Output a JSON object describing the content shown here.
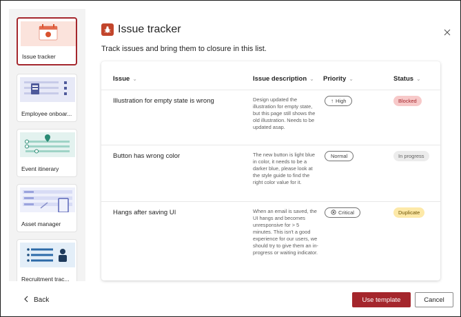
{
  "dialog": {
    "title": "Issue tracker",
    "subtitle": "Track issues and bring them to closure in this list.",
    "close_icon": "close-icon",
    "app_icon": "bug-icon",
    "accent_color": "#a4262c"
  },
  "templates": [
    {
      "label": "Issue tracker",
      "selected": true,
      "icon": "calendar-bug-icon"
    },
    {
      "label": "Employee onboar...",
      "selected": false,
      "icon": "clipboard-icon"
    },
    {
      "label": "Event itinerary",
      "selected": false,
      "icon": "map-pin-icon"
    },
    {
      "label": "Asset manager",
      "selected": false,
      "icon": "device-icon"
    },
    {
      "label": "Recruitment trac...",
      "selected": false,
      "icon": "person-list-icon"
    }
  ],
  "table": {
    "columns": [
      "Issue",
      "Issue description",
      "Priority",
      "Status"
    ],
    "rows": [
      {
        "issue": "Illustration for empty state is wrong",
        "description": "Design updated the illustration for empty state, but this page still shows the old illustration. Needs to be updated asap.",
        "priority": "High",
        "priority_icon": "arrow-up-icon",
        "status": "Blocked",
        "status_bg": "#f7c9c9",
        "status_fg": "#a4262c"
      },
      {
        "issue": "Button has wrong color",
        "description": "The new button is light blue in color, it needs to be a darker blue, please look at the style guide to find the right color value for it.",
        "priority": "Normal",
        "priority_icon": "",
        "status": "In progress",
        "status_bg": "#ececec",
        "status_fg": "#616161"
      },
      {
        "issue": "Hangs after saving UI",
        "description": "When an email is saved, the UI hangs and becomes unresponsive for > 5 minutes. This isn't a good experience for our users, we should try to give them an in-progress or waiting indicator.",
        "priority": "Critical",
        "priority_icon": "error-circle-icon",
        "status": "Duplicate",
        "status_bg": "#fde9a8",
        "status_fg": "#6b5100"
      }
    ]
  },
  "footer": {
    "back_label": "Back",
    "primary_label": "Use template",
    "secondary_label": "Cancel"
  }
}
